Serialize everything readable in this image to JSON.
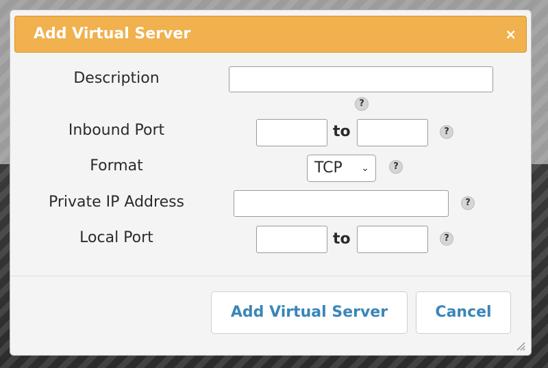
{
  "dialog": {
    "title": "Add Virtual Server",
    "close_glyph": "×"
  },
  "form": {
    "description_label": "Description",
    "description_value": "",
    "inbound_port_label": "Inbound Port",
    "inbound_port_from": "",
    "inbound_port_to": "",
    "to_label": "to",
    "format_label": "Format",
    "format_value": "TCP",
    "private_ip_label": "Private IP Address",
    "private_ip_value": "",
    "local_port_label": "Local Port",
    "local_port_from": "",
    "local_port_to": "",
    "help_glyph": "?"
  },
  "buttons": {
    "add_label": "Add Virtual Server",
    "cancel_label": "Cancel"
  },
  "colors": {
    "header": "#f0b14e",
    "button_text": "#3a86b8"
  }
}
